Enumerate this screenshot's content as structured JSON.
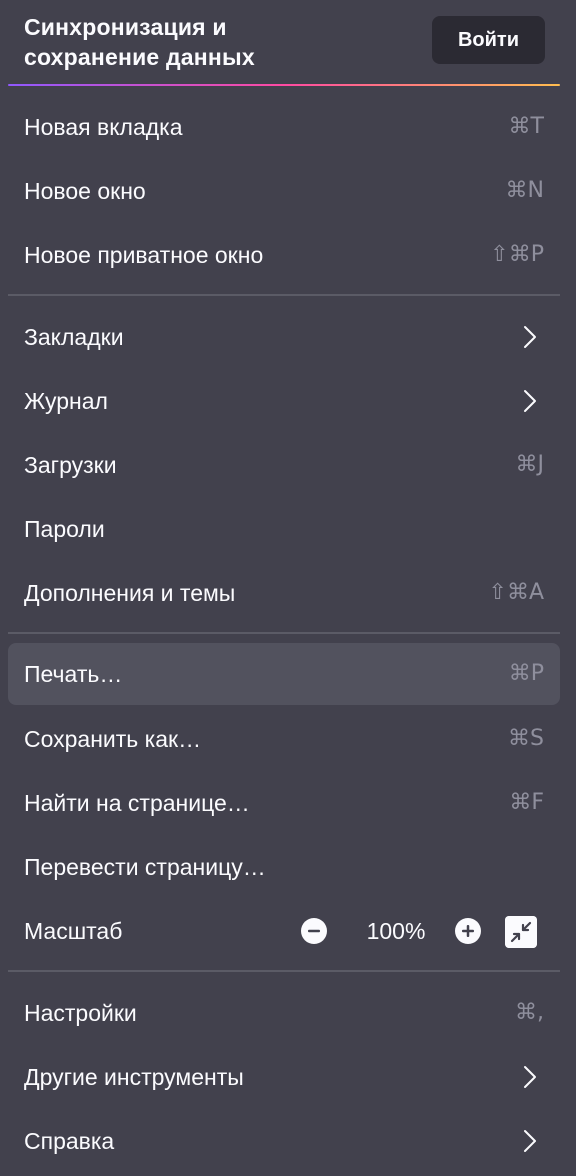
{
  "theme": {
    "background": "#42414d",
    "text": "#fbfbfe",
    "shortcut_text": "#8f8f9d",
    "hover_background": "#52525e",
    "separator": "#5b5b66",
    "button_background": "#2b2a33",
    "accent_gradient": [
      "#9059ff",
      "#ff4aa2",
      "#ffbd4f"
    ]
  },
  "header": {
    "title_line1": "Синхронизация и",
    "title_line2": "сохранение данных",
    "signin_label": "Войти"
  },
  "sections": [
    {
      "items": [
        {
          "label": "Новая вкладка",
          "shortcut": "⌘T"
        },
        {
          "label": "Новое окно",
          "shortcut": "⌘N"
        },
        {
          "label": "Новое приватное окно",
          "shortcut": "⇧⌘P"
        }
      ]
    },
    {
      "items": [
        {
          "label": "Закладки",
          "submenu": true,
          "icon": "chevron-right-icon"
        },
        {
          "label": "Журнал",
          "submenu": true,
          "icon": "chevron-right-icon"
        },
        {
          "label": "Загрузки",
          "shortcut": "⌘J"
        },
        {
          "label": "Пароли"
        },
        {
          "label": "Дополнения и темы",
          "shortcut": "⇧⌘A"
        }
      ]
    },
    {
      "items": [
        {
          "label": "Печать…",
          "shortcut": "⌘P",
          "highlighted": true
        },
        {
          "label": "Сохранить как…",
          "shortcut": "⌘S"
        },
        {
          "label": "Найти на странице…",
          "shortcut": "⌘F"
        },
        {
          "label": "Перевести страницу…"
        }
      ]
    },
    {
      "items": [
        {
          "label": "Настройки",
          "shortcut": "⌘,"
        },
        {
          "label": "Другие инструменты",
          "submenu": true,
          "icon": "chevron-right-icon"
        },
        {
          "label": "Справка",
          "submenu": true,
          "icon": "chevron-right-icon"
        }
      ]
    }
  ],
  "zoom": {
    "label": "Масштаб",
    "value": "100%",
    "decrease_icon": "minus-circle-icon",
    "increase_icon": "plus-circle-icon",
    "fullscreen_icon": "exit-fullscreen-icon"
  }
}
